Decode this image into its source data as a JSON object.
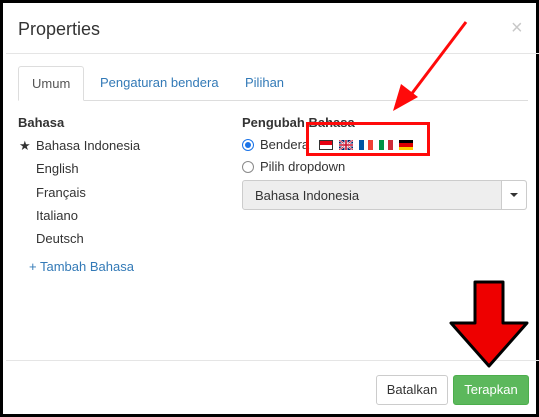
{
  "dialog": {
    "title": "Properties",
    "close_glyph": "×"
  },
  "tabs": [
    {
      "label": "Umum",
      "active": true
    },
    {
      "label": "Pengaturan bendera",
      "active": false
    },
    {
      "label": "Pilihan",
      "active": false
    }
  ],
  "languages": {
    "heading": "Bahasa",
    "default_marker": "★",
    "items": [
      "Bahasa Indonesia",
      "English",
      "Français",
      "Italiano",
      "Deutsch"
    ],
    "add_link": "+ Tambah Bahasa"
  },
  "switcher": {
    "heading": "Pengubah Bahasa",
    "options": [
      {
        "label": "Bendera",
        "selected": true
      },
      {
        "label": "Pilih dropdown",
        "selected": false
      }
    ],
    "flags": [
      "flag-id-icon",
      "flag-uk-icon",
      "flag-fr-icon",
      "flag-it-icon",
      "flag-de-icon"
    ],
    "dropdown_value": "Bahasa Indonesia"
  },
  "footer": {
    "cancel_label": "Batalkan",
    "apply_label": "Terapkan"
  },
  "colors": {
    "link": "#337ab7",
    "apply": "#5cb85c",
    "annotation": "#ff0a0a",
    "radio": "#1a73e8"
  }
}
